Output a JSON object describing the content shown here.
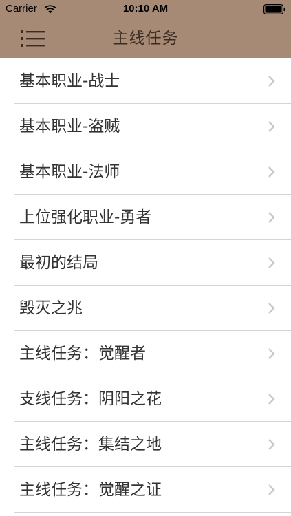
{
  "status_bar": {
    "carrier": "Carrier",
    "time": "10:10 AM"
  },
  "nav": {
    "title": "主线任务",
    "menu_icon": "list-menu-icon"
  },
  "list": {
    "chevron_icon": "chevron-right-icon",
    "items": [
      {
        "label": "基本职业-战士"
      },
      {
        "label": "基本职业-盗贼"
      },
      {
        "label": "基本职业-法师"
      },
      {
        "label": "上位强化职业-勇者"
      },
      {
        "label": "最初的结局"
      },
      {
        "label": "毁灭之兆"
      },
      {
        "label": "主线任务：觉醒者"
      },
      {
        "label": "支线任务：阴阳之花"
      },
      {
        "label": "主线任务：集结之地"
      },
      {
        "label": "主线任务：觉醒之证"
      }
    ]
  },
  "colors": {
    "header": "#a68a76",
    "title": "#3a2c22",
    "text": "#333333",
    "separator": "#d4d4d8",
    "chevron": "#c7c7cc"
  }
}
